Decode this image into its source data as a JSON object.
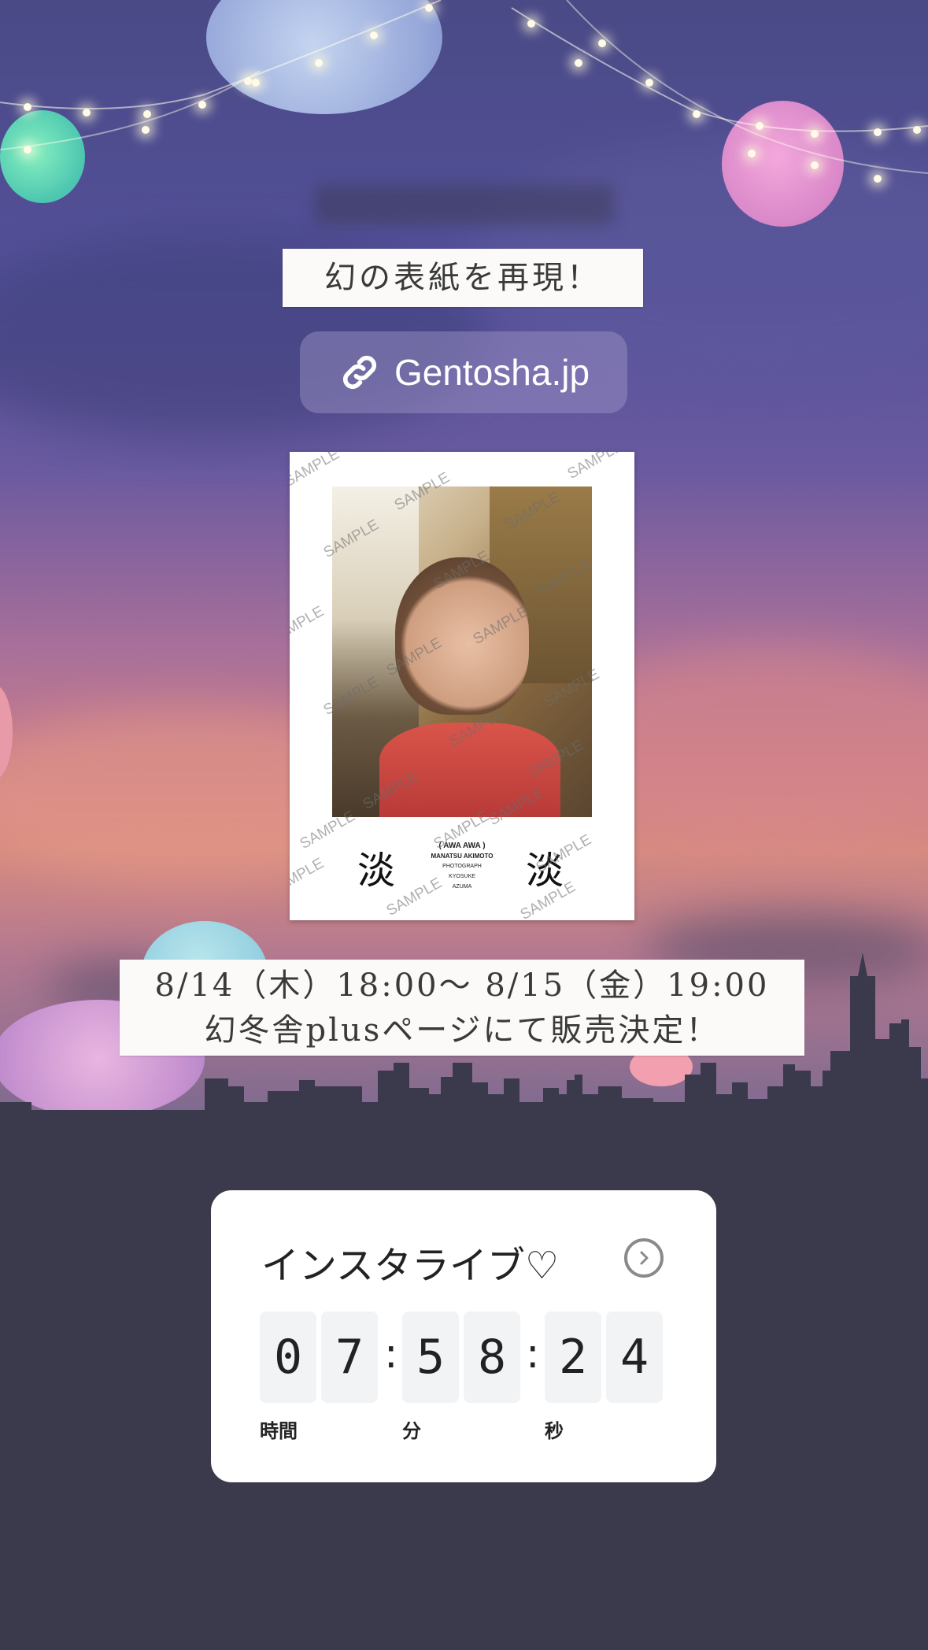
{
  "story": {
    "subtitle": "幻の表紙を再現！",
    "link_label": "Gentosha.jp",
    "cover": {
      "watermark": "SAMPLE",
      "title_left": "淡",
      "title_right": "淡",
      "title_roman": "( AWA AWA )",
      "author": "MANATSU AKIMOTO",
      "credit_line1": "PHOTOGRAPH",
      "credit_line2": "KYOSUKE",
      "credit_line3": "AZUMA"
    },
    "sale_line1": "8/14（木）18:00〜 8/15（金）19:00",
    "sale_line2": "幻冬舎plusページにて販売決定！"
  },
  "countdown": {
    "title": "インスタライブ♡",
    "hours": [
      "0",
      "7"
    ],
    "minutes": [
      "5",
      "8"
    ],
    "seconds": [
      "2",
      "4"
    ],
    "separator": ":",
    "unit_hours": "時間",
    "unit_minutes": "分",
    "unit_seconds": "秒",
    "icon": "chevron-right-icon"
  }
}
